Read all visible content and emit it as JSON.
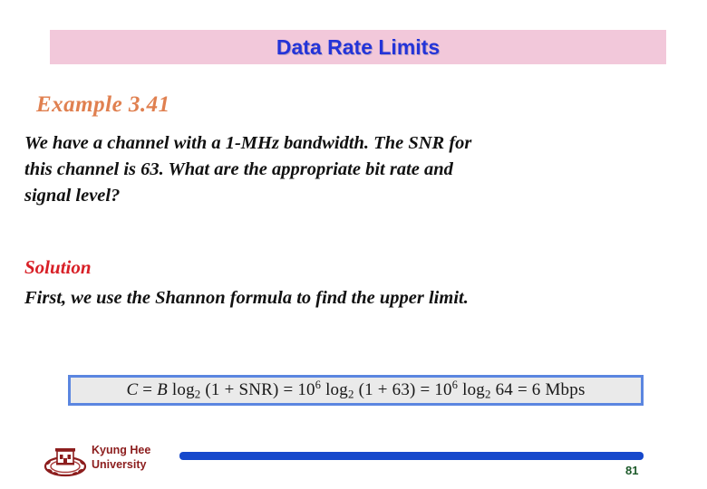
{
  "slide": {
    "title": "Data Rate Limits",
    "title_color": "#2434d8",
    "title_band_color": "#f2c8da",
    "example": {
      "heading": "Example 3.41",
      "heading_color": "#e08050",
      "question_lines": [
        "We have a channel with a 1-MHz bandwidth. The SNR for",
        "this channel is 63. What are the appropriate bit rate and",
        "signal level?"
      ],
      "question_full": "We have a channel with a 1-MHz bandwidth. The SNR for this channel is 63. What are the appropriate bit rate and signal level?"
    },
    "solution": {
      "heading": "Solution",
      "heading_color": "#d81f26",
      "text": "First, we use the Shannon formula to find the upper limit."
    },
    "formula": {
      "plain": "C = B log2 (1 + SNR) = 10^6 log2 (1 + 63) = 10^6 log2 64 = 6 Mbps",
      "parts": {
        "c": "C",
        "equals1": " = ",
        "b": "B",
        "log1": " log",
        "sub2_a": "2",
        "snr_group": " (1 + SNR) = 10",
        "sup6_a": "6",
        "log2": " log",
        "sub2_b": "2",
        "sixtythree_group": " (1 + 63) = 10",
        "sup6_b": "6",
        "log3": " log",
        "sub2_c": "2",
        "tail": " 64 = 6 Mbps"
      },
      "border_color": "#5b86e0",
      "fill_color": "#eaeaea"
    },
    "footer": {
      "university_line1": "Kyung Hee",
      "university_line2": "University",
      "university_color": "#8c1d1d",
      "bar_color": "#1648cc",
      "page_number": "81",
      "page_number_color": "#1d5a2a",
      "logo_icon": "kyung-hee-crest-icon"
    }
  }
}
